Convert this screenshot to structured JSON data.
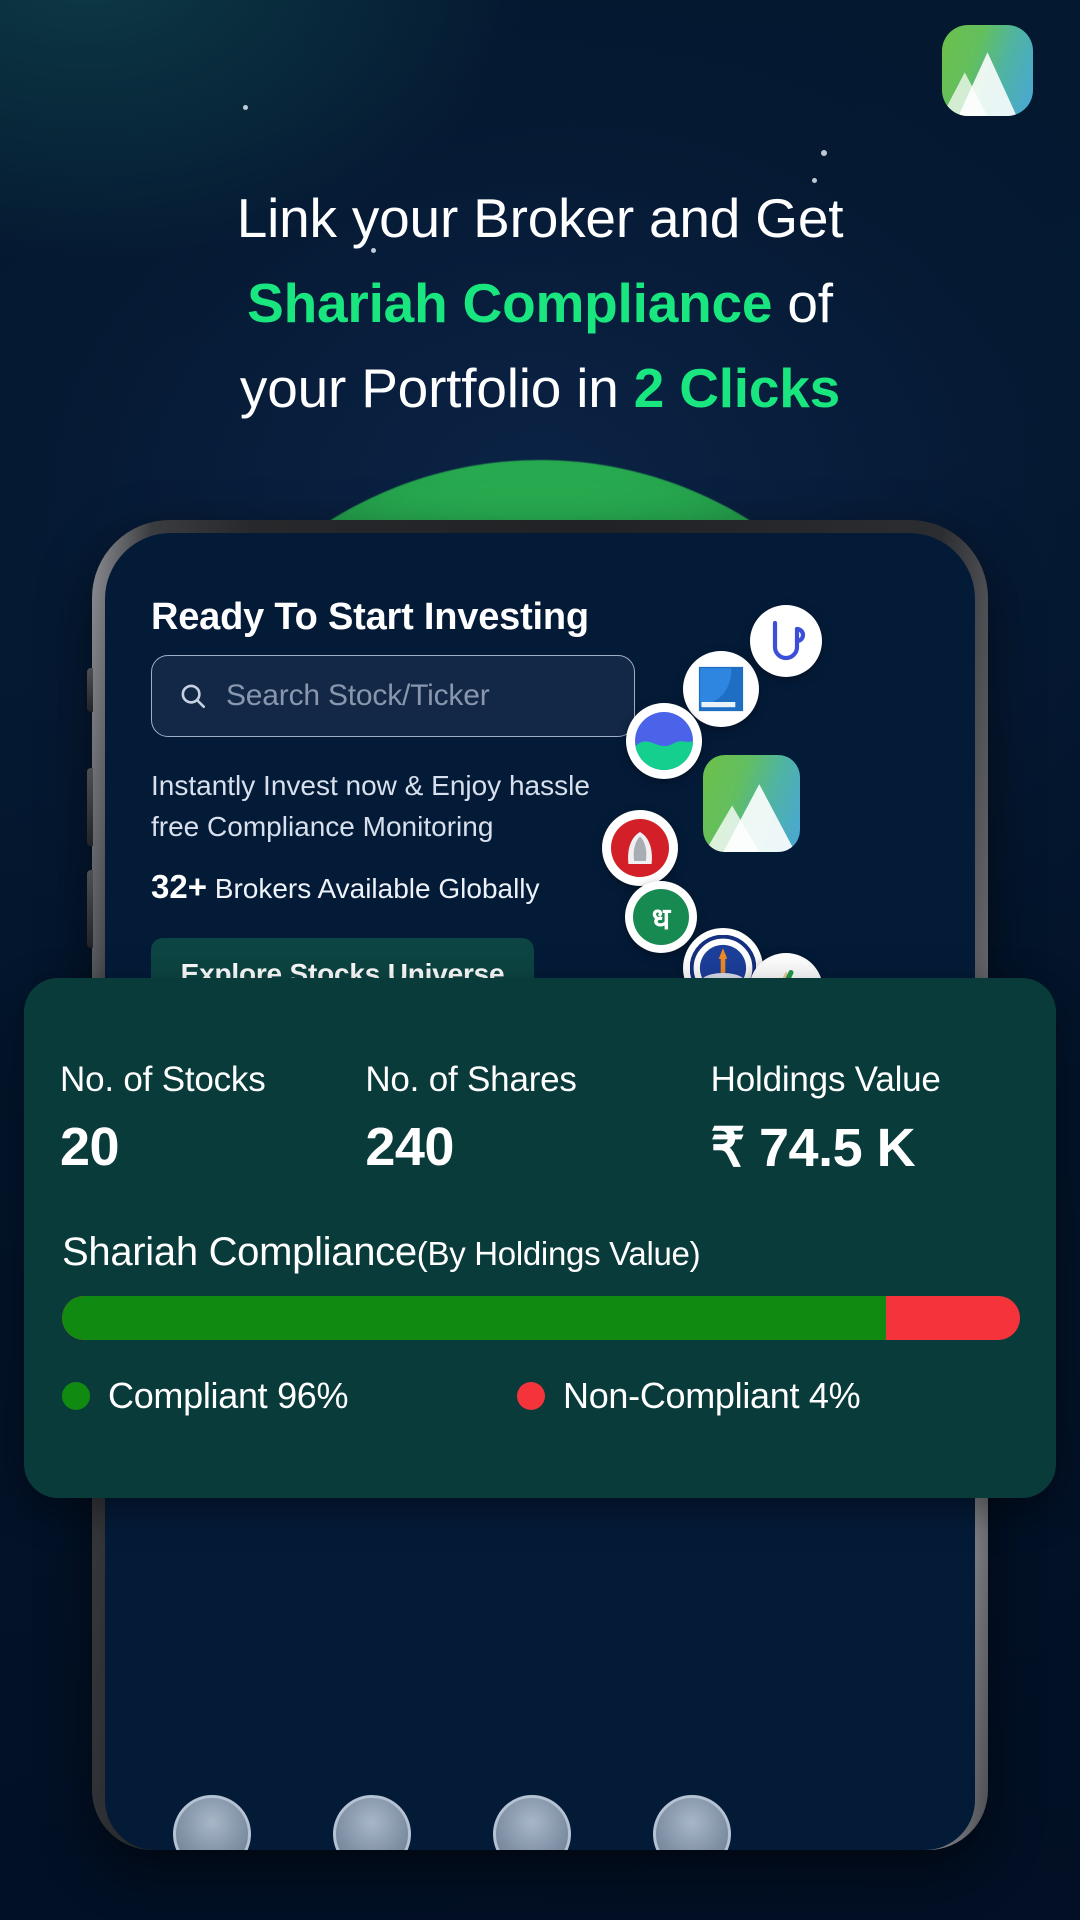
{
  "brand": {
    "logo_icon": "musaffa-mountain-logo-icon",
    "accent_green": "#19e67f",
    "card_bg": "#0a3b3b"
  },
  "headline": {
    "line1": "Link your Broker and Get",
    "line2_accent": "Shariah Compliance",
    "line2_tail": " of",
    "line3_lead": "your Portfolio in ",
    "line3_accent": "2 Clicks"
  },
  "phone": {
    "screen_title": "Ready To Start Investing",
    "search": {
      "placeholder": "Search Stock/Ticker",
      "value": "",
      "icon": "search-icon"
    },
    "subtext": "Instantly Invest now & Enjoy hassle free Compliance Monitoring",
    "brokers": {
      "count": "32+",
      "text": " Brokers Available Globally"
    },
    "cta_label": "Explore Stocks Universe",
    "broker_logos": [
      {
        "name": "broker-logo-upstox",
        "type": "circle"
      },
      {
        "name": "broker-logo-fyers",
        "type": "circle"
      },
      {
        "name": "broker-logo-groww",
        "type": "circle"
      },
      {
        "name": "broker-logo-angelone",
        "type": "circle"
      },
      {
        "name": "broker-logo-musaffa",
        "type": "square"
      },
      {
        "name": "broker-logo-dhan",
        "type": "circle",
        "glyph": "ध"
      },
      {
        "name": "broker-logo-sbi-securities",
        "type": "circle"
      },
      {
        "name": "broker-logo-motilal-oswal",
        "type": "circle"
      }
    ]
  },
  "stats_card": {
    "stats": [
      {
        "label": "No. of Stocks",
        "value": "20"
      },
      {
        "label": "No. of Shares",
        "value": "240"
      },
      {
        "label": "Holdings Value",
        "value": "₹ 74.5 K"
      }
    ],
    "compliance_title": "Shariah Compliance",
    "compliance_subtitle": "(By Holdings Value)",
    "legend": [
      {
        "label": "Compliant 96%",
        "color": "#108a10"
      },
      {
        "label": "Non-Compliant 4%",
        "color": "#f5333b"
      }
    ]
  },
  "chart_data": {
    "type": "bar",
    "title": "Shariah Compliance (By Holdings Value)",
    "categories": [
      "Compliant",
      "Non-Compliant"
    ],
    "values": [
      96,
      4
    ],
    "unit": "%",
    "colors": [
      "#108a10",
      "#f5333b"
    ],
    "orientation": "horizontal-stacked",
    "ylim": [
      0,
      100
    ],
    "legend_position": "bottom",
    "grid": false,
    "xlabel": "",
    "ylabel": ""
  }
}
